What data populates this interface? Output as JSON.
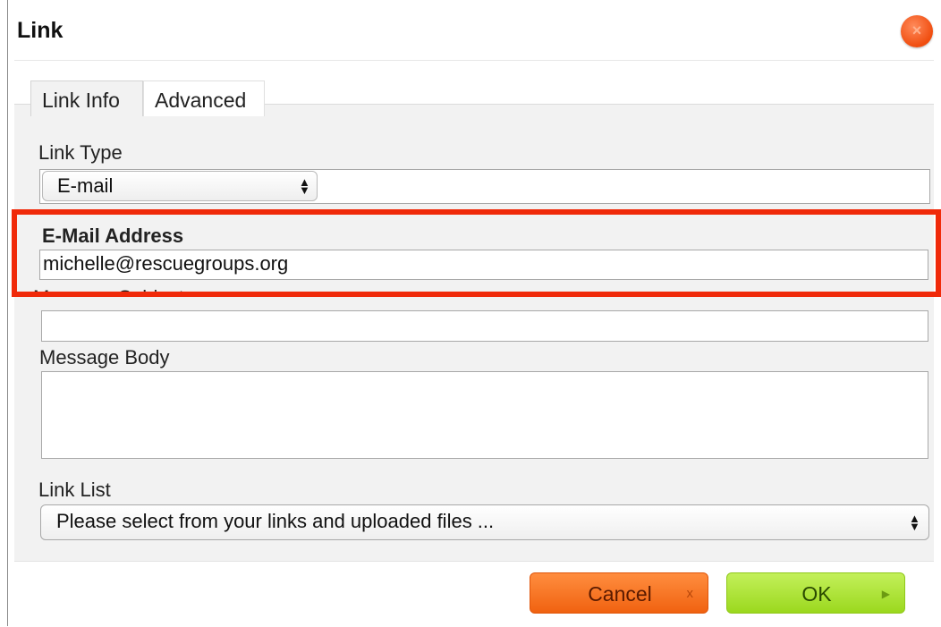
{
  "dialog": {
    "title": "Link",
    "close_icon": "×"
  },
  "tabs": [
    {
      "label": "Link Info",
      "active": true
    },
    {
      "label": "Advanced",
      "active": false
    }
  ],
  "link_type": {
    "label": "Link Type",
    "value": "E-mail"
  },
  "email": {
    "label": "E-Mail Address",
    "value": "michelle@rescuegroups.org"
  },
  "message_subject": {
    "label": "Message Subject",
    "value": ""
  },
  "message_body": {
    "label": "Message Body",
    "value": ""
  },
  "link_list": {
    "label": "Link List",
    "value": "Please select from your links and uploaded files ..."
  },
  "buttons": {
    "cancel": {
      "label": "Cancel",
      "icon": "x"
    },
    "ok": {
      "label": "OK",
      "icon": "▶"
    }
  },
  "colors": {
    "highlight": "#f02a0a",
    "cancel": "#f06210",
    "ok": "#9bd81e",
    "close": "#f04d0f"
  }
}
